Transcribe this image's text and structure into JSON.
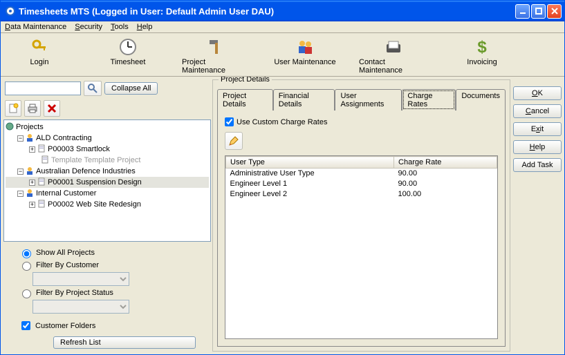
{
  "window": {
    "title": "Timesheets MTS (Logged in User: Default Admin User DAU)"
  },
  "menubar": [
    {
      "label": "Data Maintenance",
      "u": 0
    },
    {
      "label": "Security",
      "u": 0
    },
    {
      "label": "Tools",
      "u": 0
    },
    {
      "label": "Help",
      "u": 0
    }
  ],
  "toolbar": [
    {
      "name": "login",
      "label": "Login",
      "icon": "keys"
    },
    {
      "name": "timesheet",
      "label": "Timesheet",
      "icon": "clock"
    },
    {
      "name": "project-maintenance",
      "label": "Project Maintenance",
      "icon": "hammer"
    },
    {
      "name": "user-maintenance",
      "label": "User Maintenance",
      "icon": "people"
    },
    {
      "name": "contact-maintenance",
      "label": "Contact Maintenance",
      "icon": "rolodex"
    },
    {
      "name": "invoicing",
      "label": "Invoicing",
      "icon": "dollar"
    }
  ],
  "search": {
    "value": "",
    "collapse_label": "Collapse All"
  },
  "tree": {
    "root": "Projects",
    "nodes": [
      {
        "label": "ALD Contracting",
        "level": 1,
        "icon": "person",
        "expander": "-"
      },
      {
        "label": "P00003 Smartlock",
        "level": 2,
        "icon": "doc",
        "expander": "+"
      },
      {
        "label": "Template Template Project",
        "level": 2,
        "icon": "doc",
        "grey": true
      },
      {
        "label": "Australian Defence Industries",
        "level": 1,
        "icon": "person",
        "expander": "-"
      },
      {
        "label": "P00001 Suspension Design",
        "level": 2,
        "icon": "doc",
        "expander": "+",
        "selected": true
      },
      {
        "label": "Internal Customer",
        "level": 1,
        "icon": "person",
        "expander": "-"
      },
      {
        "label": "P00002 Web Site Redesign",
        "level": 2,
        "icon": "doc",
        "expander": "+"
      }
    ]
  },
  "filters": {
    "show_all_label": "Show All Projects",
    "by_customer_label": "Filter By Customer",
    "by_status_label": "Filter By Project Status",
    "customer_folders_label": "Customer Folders",
    "refresh_label": "Refresh List",
    "selected": "show_all",
    "customer_folders_checked": true
  },
  "details": {
    "group_label": "Project Details",
    "tabs": [
      "Project Details",
      "Financial Details",
      "User Assignments",
      "Charge Rates",
      "Documents"
    ],
    "active_tab": 3,
    "use_custom_label": "Use Custom Charge Rates",
    "use_custom_checked": true,
    "columns": [
      "User Type",
      "Charge Rate"
    ],
    "rows": [
      {
        "user_type": "Administrative User Type",
        "rate": "90.00"
      },
      {
        "user_type": "Engineer Level 1",
        "rate": "90.00"
      },
      {
        "user_type": "Engineer Level 2",
        "rate": "100.00"
      }
    ]
  },
  "actions": {
    "ok": "OK",
    "cancel": "Cancel",
    "exit": "Exit",
    "help": "Help",
    "add_task": "Add Task"
  }
}
